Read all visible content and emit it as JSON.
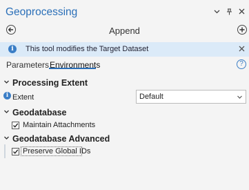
{
  "window": {
    "title": "Geoprocessing",
    "controls": [
      "chevron-down-icon",
      "pin-icon",
      "close-icon"
    ]
  },
  "tool": {
    "title": "Append",
    "back_icon": "back-arrow-icon",
    "add_icon": "add-icon"
  },
  "infobar": {
    "message": "This tool modifies the Target Dataset"
  },
  "tabs": [
    {
      "label": "Parameters",
      "active": false
    },
    {
      "label": "Environments",
      "active": true
    }
  ],
  "sections": {
    "processing_extent": {
      "label": "Processing Extent",
      "extent_label": "Extent",
      "extent_value": "Default"
    },
    "geodatabase": {
      "label": "Geodatabase",
      "maintain_attachments": {
        "label": "Maintain Attachments",
        "checked": true
      }
    },
    "geodatabase_advanced": {
      "label": "Geodatabase Advanced",
      "preserve_global_ids": {
        "label": "Preserve Global IDs",
        "checked": true
      }
    }
  },
  "colors": {
    "accent": "#2a6fb8",
    "info_bar": "#dbeaf8",
    "background": "#f4f4f4"
  }
}
